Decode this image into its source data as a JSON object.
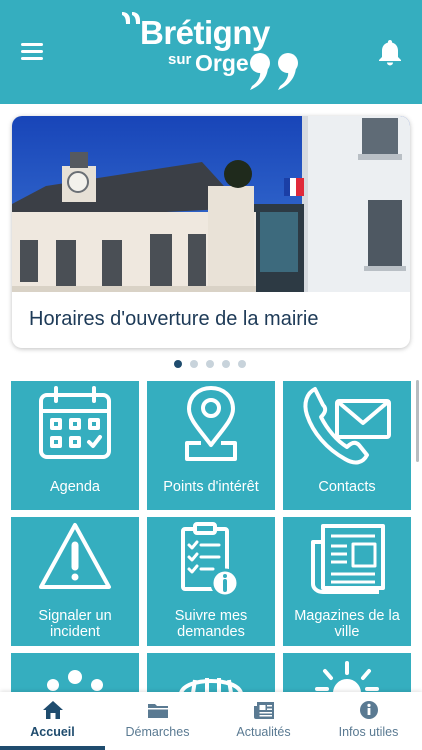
{
  "header": {
    "logo": {
      "line1": "Brétigny",
      "sur": "sur",
      "orge": "Orge"
    },
    "menu_icon": "hamburger-menu-icon",
    "bell_icon": "bell-icon",
    "background": "#35aebf"
  },
  "banner": {
    "title": "Horaires d'ouverture de la mairie",
    "dots_count": 5,
    "active_dot": 1
  },
  "tiles": [
    {
      "label": "Agenda",
      "icon": "calendar-icon"
    },
    {
      "label": "Points d'intérêt",
      "icon": "map-pin-icon"
    },
    {
      "label": "Contacts",
      "icon": "phone-envelope-icon"
    },
    {
      "label": "Signaler un incident",
      "icon": "warning-icon"
    },
    {
      "label": "Suivre mes demandes",
      "icon": "checklist-icon"
    },
    {
      "label": "Magazines de la ville",
      "icon": "newspaper-icon"
    }
  ],
  "nav": [
    {
      "label": "Accueil",
      "icon": "home-icon",
      "active": true
    },
    {
      "label": "Démarches",
      "icon": "folder-icon",
      "active": false
    },
    {
      "label": "Actualités",
      "icon": "news-icon",
      "active": false
    },
    {
      "label": "Infos utiles",
      "icon": "info-icon",
      "active": false
    }
  ],
  "colors": {
    "accent": "#35aebf",
    "navy": "#1f4c6e",
    "title": "#1d3a57"
  }
}
